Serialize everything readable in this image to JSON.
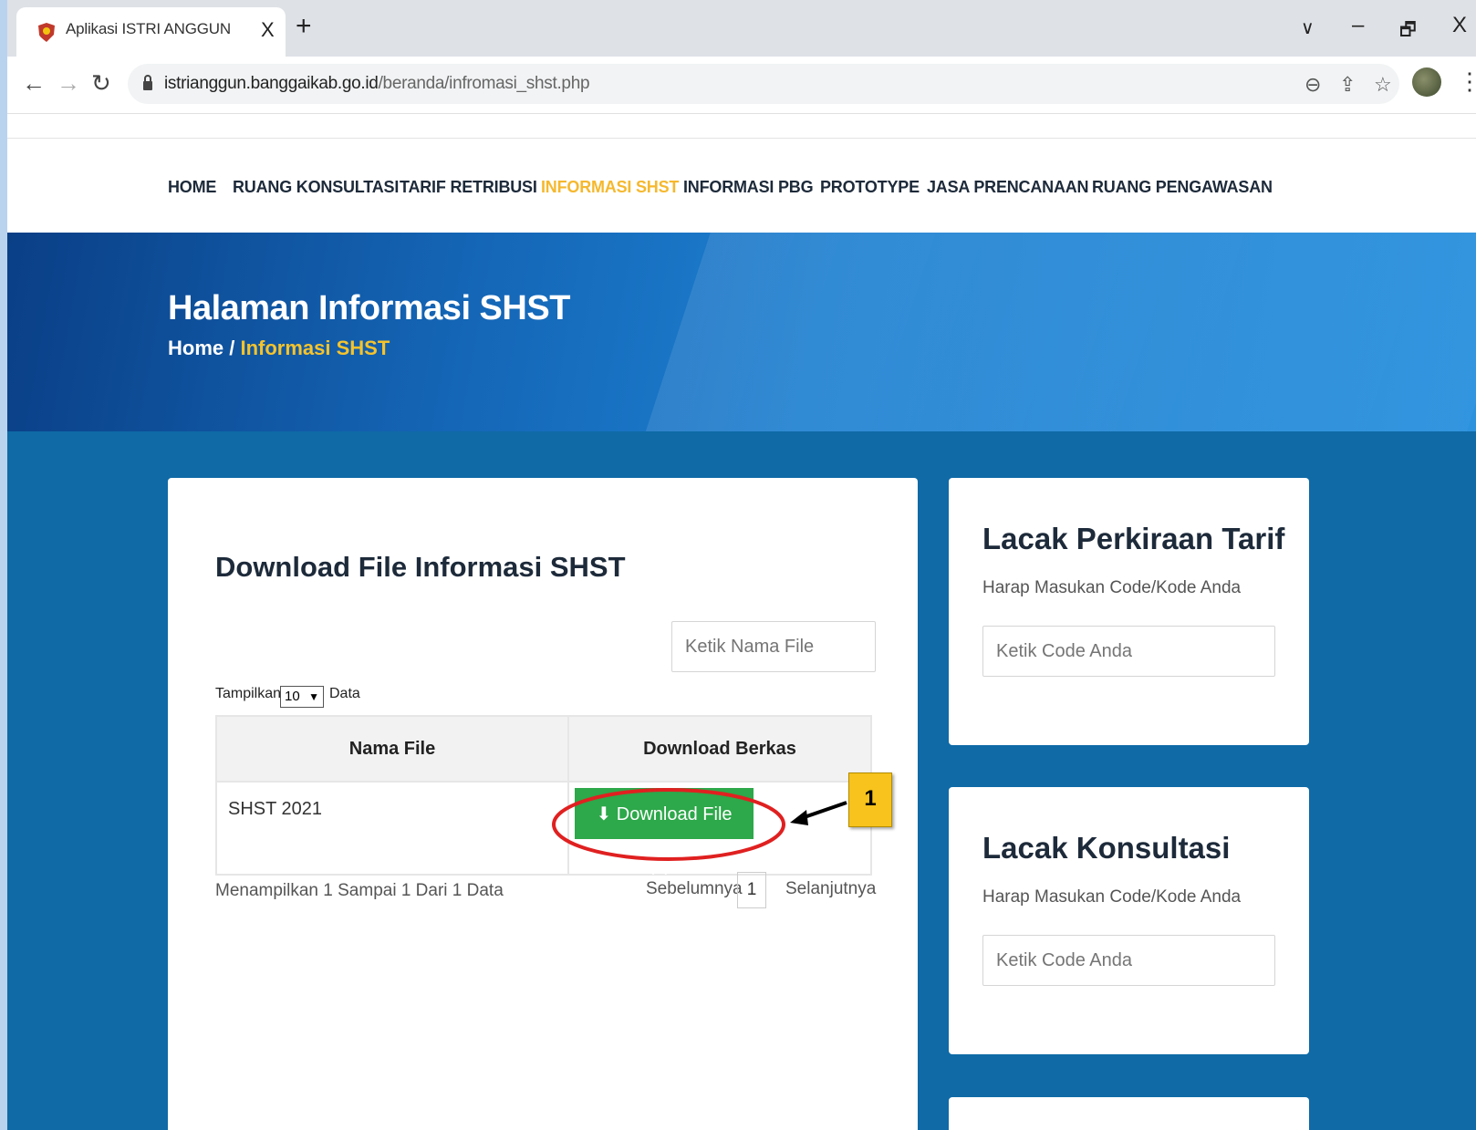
{
  "browser": {
    "tab_title": "Aplikasi ISTRI ANGGUN",
    "tab_close": "X",
    "new_tab": "+",
    "url_host": "istrianggun.banggaikab.go.id",
    "url_path": "/beranda/infromasi_shst.php",
    "window_controls": {
      "dropdown": "∨",
      "minimize": "–",
      "restore": "🗗",
      "close": "X"
    }
  },
  "nav": {
    "items": [
      "HOME",
      "RUANG KONSULTASI",
      "TARIF RETRIBUSI",
      "INFORMASI SHST",
      "INFORMASI PBG",
      "PROTOTYPE",
      "JASA PRENCANAAN",
      "RUANG PENGAWASAN"
    ],
    "active": "INFORMASI SHST"
  },
  "hero": {
    "title": "Halaman Informasi SHST",
    "crumb_home": "Home",
    "crumb_sep": " / ",
    "crumb_current": "Informasi SHST"
  },
  "main_card": {
    "title": "Download File Informasi SHST",
    "search_placeholder": "Ketik Nama File",
    "show_prefix": "Tampilkan",
    "show_value": "10",
    "show_suffix": "Data",
    "columns": [
      "Nama File",
      "Download Berkas"
    ],
    "rows": [
      {
        "name": "SHST 2021",
        "button": "Download File (1)x"
      }
    ],
    "info": "Menampilkan 1 Sampai 1 Dari 1 Data",
    "prev": "Sebelumnya",
    "page": "1",
    "next": "Selanjutnya"
  },
  "side_cards": [
    {
      "title": "Lacak Perkiraan Tarif",
      "hint": "Harap Masukan Code/Kode Anda",
      "placeholder": "Ketik Code Anda"
    },
    {
      "title": "Lacak Konsultasi",
      "hint": "Harap Masukan Code/Kode Anda",
      "placeholder": "Ketik Code Anda"
    }
  ],
  "annotation": {
    "number": "1"
  },
  "colors": {
    "accent": "#f5b82e",
    "page_bg": "#0f6aa6",
    "button": "#2da84a",
    "highlight": "#e02020"
  }
}
